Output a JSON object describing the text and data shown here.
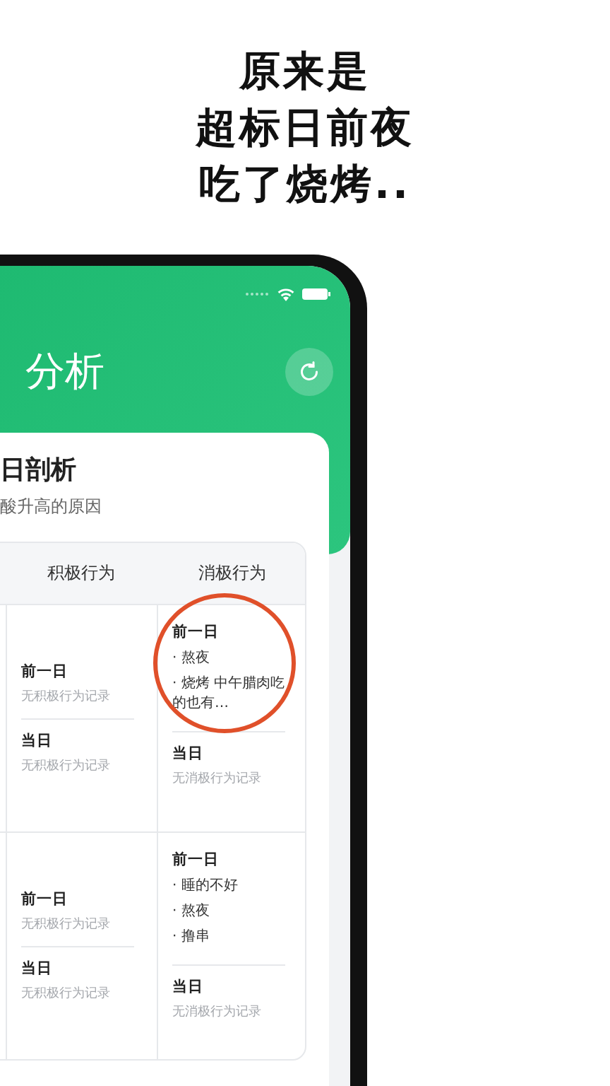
{
  "caption": {
    "lines": [
      "原来是",
      "超标日前夜",
      "吃了烧烤.."
    ]
  },
  "header": {
    "title": "分析"
  },
  "card": {
    "title": "日剖析",
    "subtitle": "酸升高的原因"
  },
  "table": {
    "columns": [
      "积极行为",
      "消极行为"
    ],
    "rows": [
      {
        "positive": [
          {
            "label": "前一日",
            "kind": "empty",
            "items": [
              "无积极行为记录"
            ]
          },
          {
            "label": "当日",
            "kind": "empty",
            "items": [
              "无积极行为记录"
            ]
          }
        ],
        "negative": [
          {
            "label": "前一日",
            "kind": "list",
            "items": [
              "· 熬夜",
              "· 烧烤 中午腊肉吃的也有…"
            ]
          },
          {
            "label": "当日",
            "kind": "empty",
            "items": [
              "无消极行为记录"
            ]
          }
        ]
      },
      {
        "positive": [
          {
            "label": "前一日",
            "kind": "empty",
            "items": [
              "无积极行为记录"
            ]
          },
          {
            "label": "当日",
            "kind": "empty",
            "items": [
              "无积极行为记录"
            ]
          }
        ],
        "negative": [
          {
            "label": "前一日",
            "kind": "list",
            "items": [
              "· 睡的不好",
              "· 熬夜",
              "· 撸串"
            ]
          },
          {
            "label": "当日",
            "kind": "empty",
            "items": [
              "无消极行为记录"
            ]
          }
        ]
      }
    ]
  }
}
